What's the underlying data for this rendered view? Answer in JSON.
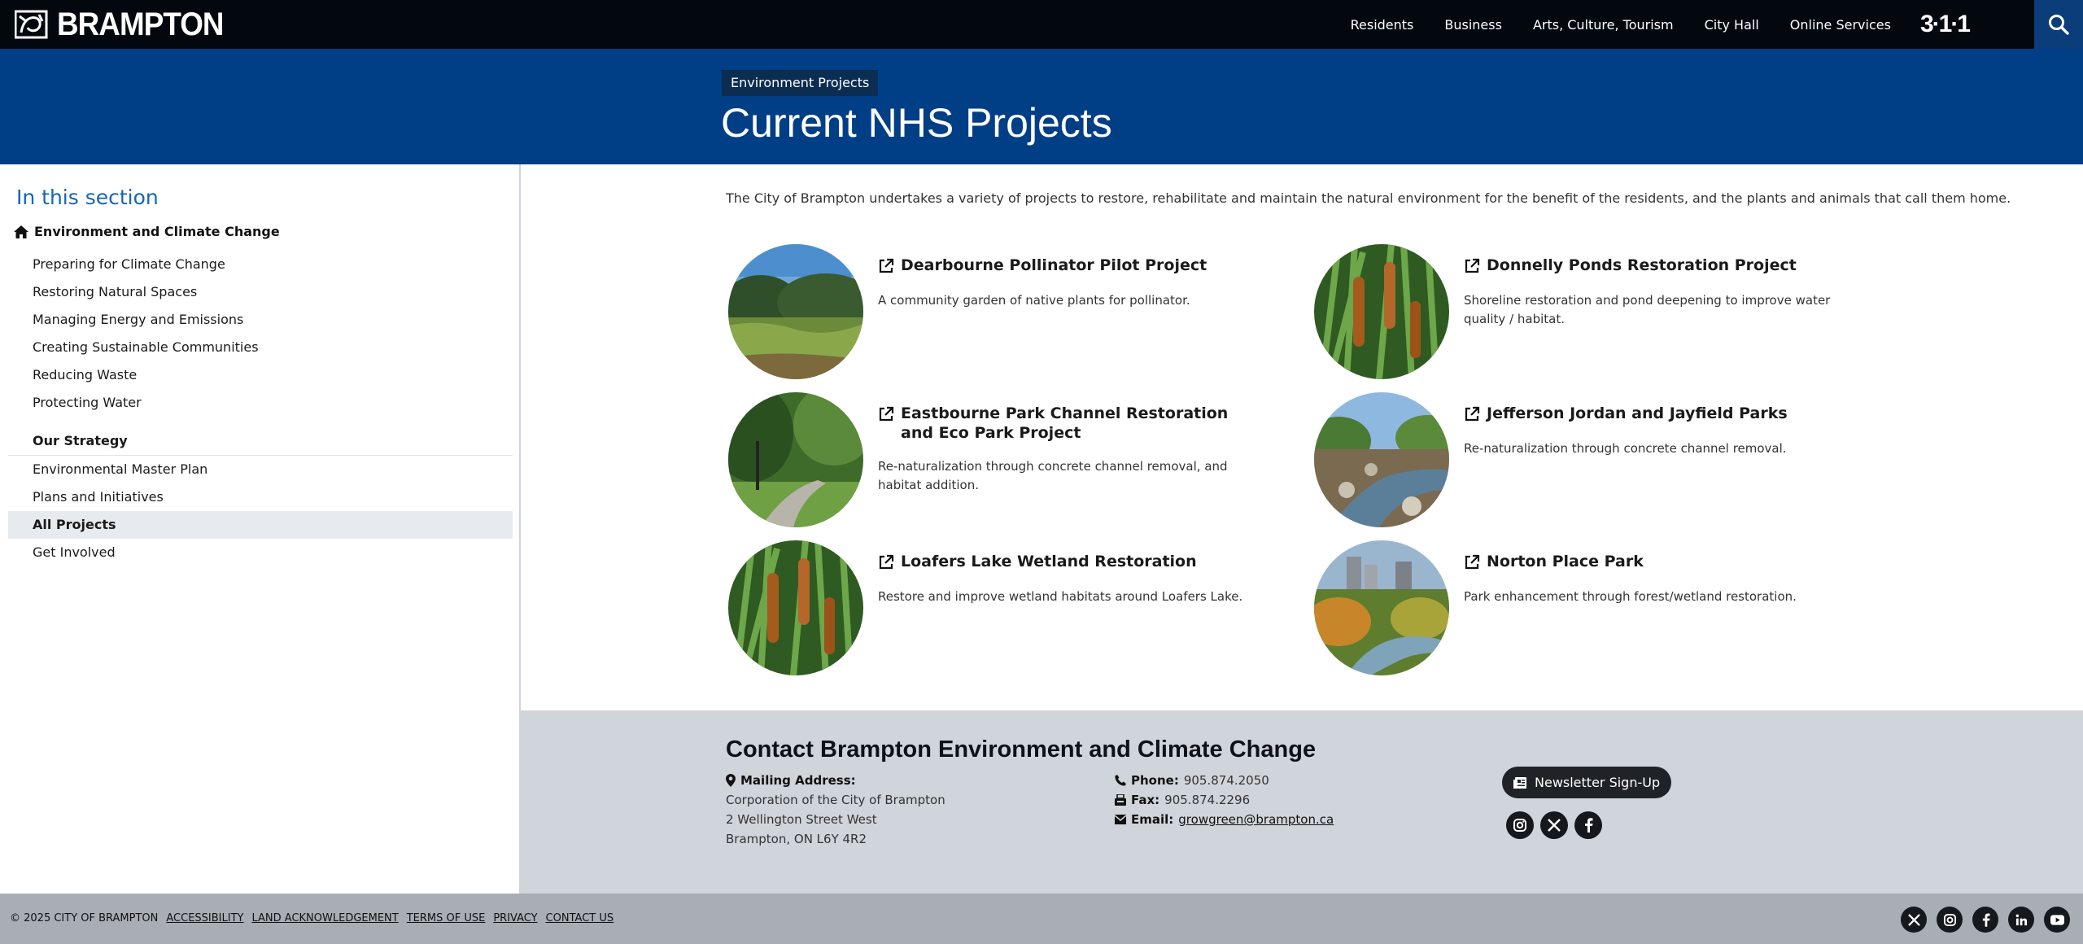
{
  "brand": {
    "name": "BRAMPTON",
    "logo_icon": "city-logo-icon"
  },
  "nav": {
    "items": [
      "Residents",
      "Business",
      "Arts, Culture, Tourism",
      "City Hall",
      "Online Services"
    ],
    "badge_311": "3·1·1",
    "search_icon": "search-icon"
  },
  "hero": {
    "tag": "Environment Projects",
    "title": "Current NHS Projects",
    "bg_color": "#003e85"
  },
  "sidebar": {
    "heading": "In this section",
    "root": "Environment and Climate Change",
    "items": [
      "Preparing for Climate Change",
      "Restoring Natural Spaces",
      "Managing Energy and Emissions",
      "Creating Sustainable Communities",
      "Reducing Waste",
      "Protecting Water"
    ],
    "group_title": "Our Strategy",
    "group_items": [
      "Environmental Master Plan",
      "Plans and Initiatives",
      "All Projects",
      "Get Involved"
    ],
    "active": "All Projects"
  },
  "intro": "The City of Brampton undertakes a variety of projects to restore, rehabilitate and maintain the natural environment for the benefit of the residents, and the plants and animals that call them home.",
  "projects": [
    {
      "title": "Dearbourne Pollinator Pilot Project",
      "desc": "A community garden of native plants for pollinator."
    },
    {
      "title": "Donnelly Ponds Restoration Project",
      "desc": "Shoreline restoration and pond deepening to improve water quality / habitat."
    },
    {
      "title": "Eastbourne Park Channel Restoration and Eco Park Project",
      "desc": "Re-naturalization through concrete channel removal, and habitat addition."
    },
    {
      "title": "Jefferson Jordan and Jayfield Parks",
      "desc": "Re-naturalization through concrete channel removal."
    },
    {
      "title": "Loafers Lake Wetland Restoration",
      "desc": "Restore and improve wetland habitats around Loafers Lake."
    },
    {
      "title": "Norton Place Park",
      "desc": "Park enhancement through forest/wetland restoration."
    }
  ],
  "contact": {
    "title": "Contact Brampton Environment and Climate Change",
    "mailing_label": "Mailing Address:",
    "address": [
      "Corporation of the City of Brampton",
      "2 Wellington Street West",
      "Brampton, ON L6Y 4R2"
    ],
    "phone_label": "Phone:",
    "phone": "905.874.2050",
    "fax_label": "Fax:",
    "fax": "905.874.2296",
    "email_label": "Email:",
    "email": "growgreen@brampton.ca",
    "newsletter": "Newsletter Sign-Up",
    "social_icons": [
      "instagram-icon",
      "x-icon",
      "facebook-icon"
    ]
  },
  "footer": {
    "copyright": "© 2025 CITY OF BRAMPTON",
    "links": [
      "ACCESSIBILITY",
      "LAND ACKNOWLEDGEMENT",
      "TERMS OF USE",
      "PRIVACY",
      "CONTACT US"
    ],
    "social_icons": [
      "x-icon",
      "instagram-icon",
      "facebook-icon",
      "linkedin-icon",
      "youtube-icon"
    ]
  }
}
